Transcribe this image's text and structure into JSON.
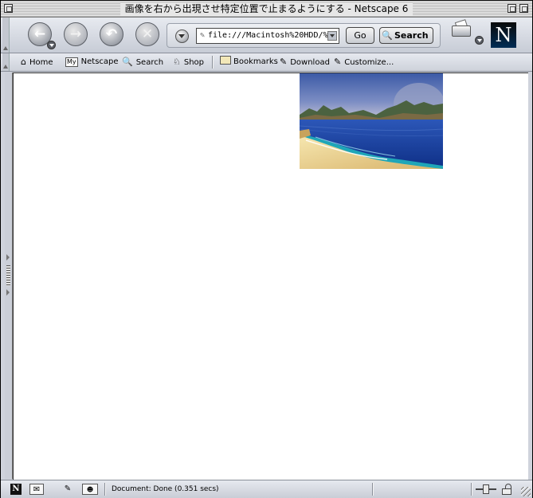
{
  "window": {
    "title": "画像を右から出現させ特定位置で止まるようにする - Netscape 6"
  },
  "nav": {
    "back_icon": "back-arrow-icon",
    "forward_icon": "forward-arrow-icon",
    "reload_icon": "reload-icon",
    "stop_icon": "stop-icon",
    "url": "file:///Macintosh%20HDD/%9",
    "go_label": "Go",
    "search_label": "Search"
  },
  "personal_toolbar": {
    "items": [
      {
        "label": "Home",
        "icon": "home-icon"
      },
      {
        "label": "Netscape",
        "icon": "my-netscape-icon",
        "badge": "My"
      },
      {
        "label": "Search",
        "icon": "magnifier-icon"
      },
      {
        "label": "Shop",
        "icon": "shop-icon"
      },
      {
        "label": "Bookmarks",
        "icon": "folder-icon"
      },
      {
        "label": "Download",
        "icon": "bookmark-page-icon"
      },
      {
        "label": "Customize...",
        "icon": "bookmark-page-icon"
      }
    ]
  },
  "statusbar": {
    "text": "Document: Done (0.351 secs)"
  },
  "logo": {
    "letter": "N"
  },
  "colors": {
    "chrome": "#cfd3dc",
    "sea": "#1a3f9a",
    "sand": "#f2dd9c",
    "sky": "#5a74b4"
  }
}
